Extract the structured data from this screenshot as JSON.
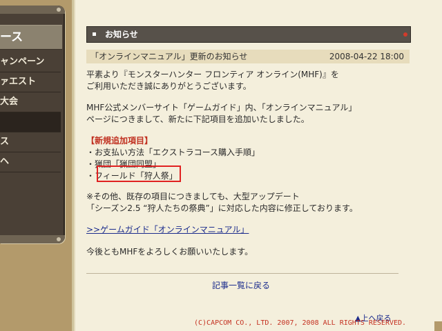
{
  "sidebar": {
    "header": "ース",
    "items": [
      {
        "label": "ャンペーン",
        "selected": false
      },
      {
        "label": "ァエスト",
        "selected": false
      },
      {
        "label": "大会",
        "selected": false
      },
      {
        "label": "",
        "selected": true
      },
      {
        "label": "ス",
        "selected": false
      },
      {
        "label": "ヘ",
        "selected": false
      }
    ]
  },
  "notice": {
    "section_title": "お知らせ",
    "article_title": "「オンラインマニュアル」更新のお知らせ",
    "date": "2008-04-22 18:00",
    "para1_line1": "平素より『モンスターハンター フロンティア オンライン(MHF)』を",
    "para1_line2": "ご利用いただき誠にありがとうございます。",
    "para2_line1": "MHF公式メンバーサイト「ゲームガイド」内、「オンラインマニュアル」",
    "para2_line2": "ページにつきまして、新たに下記項目を追加いたしました。",
    "new_items_heading": "【新規追加項目】",
    "new_items": [
      "・お支払い方法「エクストラコース購入手順」",
      "・猟団「猟団同盟」",
      "・フィールド「狩人祭」"
    ],
    "note_line1": "※その他、既存の項目につきましても、大型アップデート",
    "note_line2": "「シーズン2.5 “狩人たちの祭典”」に対応した内容に修正しております。",
    "guide_link": ">>ゲームガイド「オンラインマニュアル」",
    "closing": "今後ともMHFをよろしくお願いいたします。",
    "back_to_list": "記事一覧に戻る",
    "to_top": "▲上へ戻る",
    "copyright": "(C)CAPCOM CO., LTD. 2007, 2008 ALL RIGHTS RESERVED."
  },
  "colors": {
    "highlight_box": "#e02020",
    "heading_red": "#c03020",
    "link_blue": "#1a2b8c"
  }
}
